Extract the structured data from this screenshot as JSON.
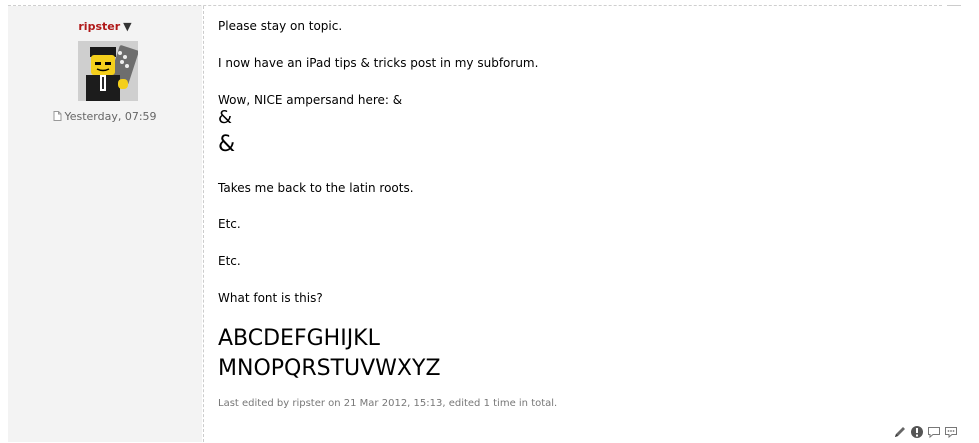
{
  "author": {
    "name": "ripster",
    "menu_arrow": "▼"
  },
  "post": {
    "date": "Yesterday, 07:59",
    "date_icon": "post-doc-icon",
    "lines": [
      "Please stay on topic.",
      "I now have an iPad tips & tricks post in my subforum.",
      "Wow, NICE ampersand here: &",
      "&",
      "&",
      "Takes me back to the latin roots.",
      "Etc.",
      "Etc.",
      "What font is this?",
      "ABCDEFGHIJKL",
      "MNOPQRSTUVWXYZ"
    ],
    "edited_note": "Last edited by ripster on 21 Mar 2012, 15:13, edited 1 time in total."
  },
  "actions": [
    "edit-icon",
    "report-icon",
    "quote-icon",
    "reply-icon"
  ]
}
